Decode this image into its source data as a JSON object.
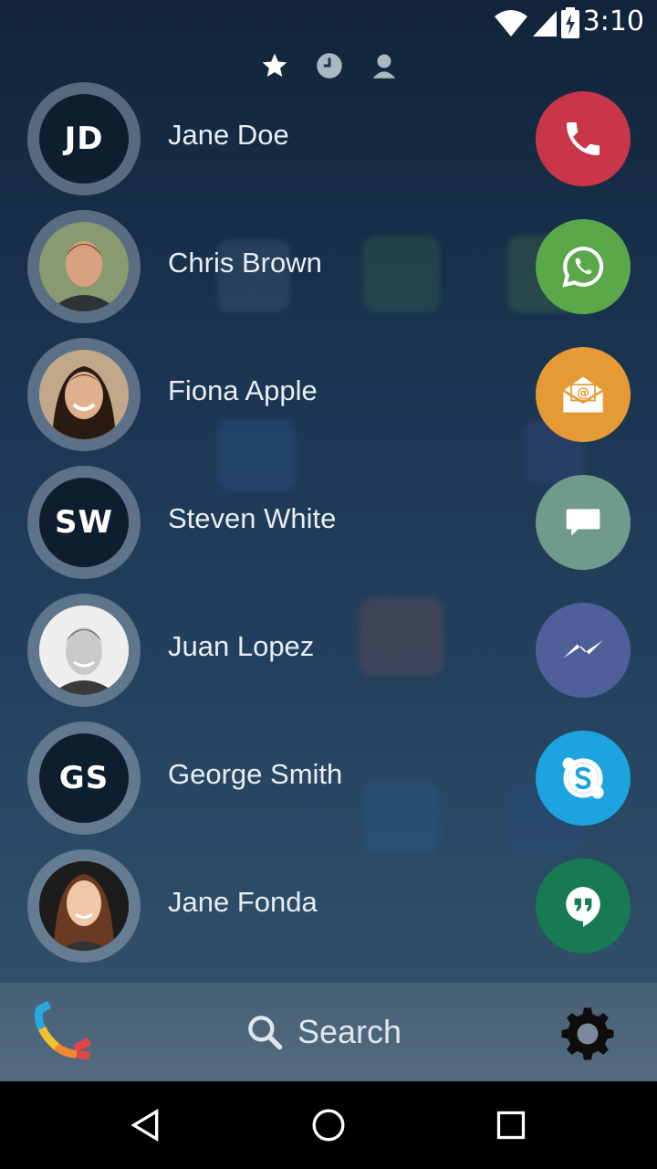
{
  "status": {
    "time": "3:10"
  },
  "tabs": [
    {
      "icon": "star-icon",
      "active": true
    },
    {
      "icon": "clock-icon",
      "active": false
    },
    {
      "icon": "person-icon",
      "active": false
    }
  ],
  "contacts": [
    {
      "name": "Jane Doe",
      "initials": "JD",
      "action": "phone-icon",
      "action_color": "#c9364a"
    },
    {
      "name": "Chris Brown",
      "initials": "",
      "action": "whatsapp-icon",
      "action_color": "#5aa84a"
    },
    {
      "name": "Fiona Apple",
      "initials": "",
      "action": "email-icon",
      "action_color": "#e59a35"
    },
    {
      "name": "Steven White",
      "initials": "SW",
      "action": "sms-icon",
      "action_color": "#6f9a8c"
    },
    {
      "name": "Juan Lopez",
      "initials": "",
      "action": "messenger-icon",
      "action_color": "#4f5f9a"
    },
    {
      "name": "George Smith",
      "initials": "GS",
      "action": "skype-icon",
      "action_color": "#1da3e0"
    },
    {
      "name": "Jane Fonda",
      "initials": "",
      "action": "hangouts-icon",
      "action_color": "#177a52"
    }
  ],
  "bottom": {
    "search_label": "Search"
  },
  "navbar": {
    "back": "back-icon",
    "home": "home-icon",
    "recents": "recents-icon"
  }
}
